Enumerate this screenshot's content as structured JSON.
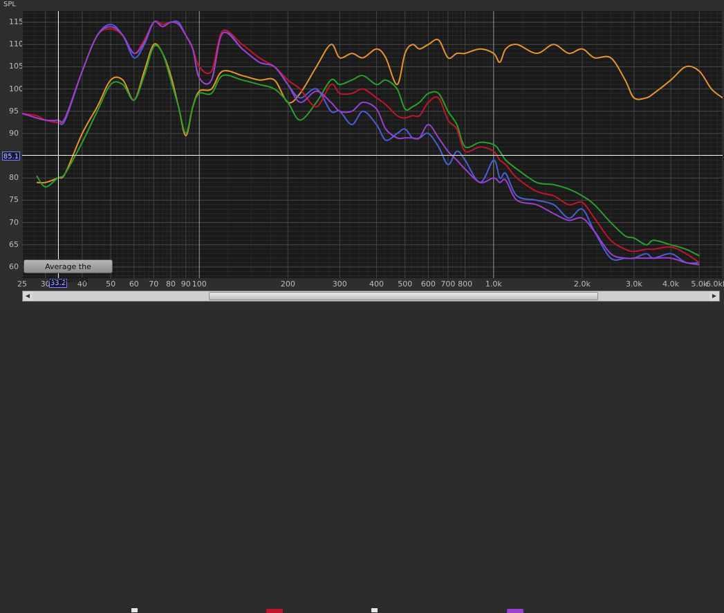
{
  "app": {
    "y_axis_title": "SPL",
    "average_button_label": "Average the Responses",
    "cursor": {
      "x_readout": "33.2",
      "y_readout": "85.1"
    },
    "scroll_left_icon": "scroll-left-arrow-icon",
    "scroll_right_icon": "scroll-right-arrow-icon"
  },
  "chart_data": {
    "type": "line",
    "ylabel": "SPL",
    "xlabel": "",
    "x_scale": "log",
    "xlim": [
      25,
      6000
    ],
    "ylim": [
      57.5,
      117.5
    ],
    "grid": true,
    "y_ticks": [
      "115",
      "110",
      "105",
      "100",
      "95",
      "90",
      "85.1",
      "80",
      "75",
      "70",
      "65",
      "60"
    ],
    "y_tick_values": [
      115,
      110,
      105,
      100,
      95,
      90,
      80,
      75,
      70,
      65,
      60
    ],
    "x_ticks": [
      "25",
      "30",
      "40",
      "50",
      "60",
      "70",
      "80",
      "90",
      "100",
      "200",
      "300",
      "400",
      "500",
      "600",
      "700",
      "800",
      "1.0k",
      "2.0k",
      "3.0k",
      "4.0k",
      "5.0k",
      "6.0kHz"
    ],
    "x_tick_values": [
      25,
      30,
      40,
      50,
      60,
      70,
      80,
      90,
      100,
      200,
      300,
      400,
      500,
      600,
      700,
      800,
      1000,
      2000,
      3000,
      4000,
      5000,
      6000
    ],
    "cursor": {
      "x": 33.2,
      "y": 85.1
    },
    "series": [
      {
        "color": "#e8952a",
        "x": [
          28,
          30,
          33,
          35,
          40,
          45,
          50,
          55,
          60,
          65,
          70,
          75,
          80,
          85,
          90,
          95,
          100,
          110,
          120,
          140,
          160,
          180,
          200,
          220,
          250,
          280,
          300,
          330,
          360,
          400,
          430,
          470,
          500,
          530,
          560,
          600,
          650,
          700,
          750,
          800,
          900,
          1000,
          1050,
          1100,
          1200,
          1400,
          1600,
          1800,
          2000,
          2200,
          2500,
          2800,
          3000,
          3300,
          3500,
          4000,
          4500,
          5000,
          5500,
          6000
        ],
        "y": [
          79,
          79,
          80,
          81,
          90,
          96,
          102,
          102,
          97.5,
          104,
          110,
          108,
          103,
          96,
          89.5,
          96,
          99.5,
          100,
          104,
          103,
          102,
          102,
          97,
          99,
          105,
          110,
          107,
          108,
          107,
          109,
          107,
          101,
          108,
          110,
          109,
          110,
          111,
          107,
          108,
          108,
          109,
          108,
          106,
          109,
          110,
          108,
          110,
          108,
          109,
          107,
          107,
          102,
          98,
          98,
          99,
          102,
          105,
          104,
          100,
          98
        ]
      },
      {
        "color": "#2aa02a",
        "x": [
          28,
          30,
          33,
          35,
          40,
          45,
          50,
          55,
          60,
          65,
          70,
          75,
          80,
          85,
          90,
          95,
          100,
          110,
          120,
          140,
          160,
          180,
          200,
          220,
          250,
          280,
          300,
          330,
          360,
          400,
          430,
          470,
          500,
          530,
          560,
          600,
          650,
          700,
          750,
          800,
          900,
          1000,
          1050,
          1100,
          1200,
          1400,
          1600,
          1800,
          2000,
          2200,
          2500,
          2800,
          3000,
          3300,
          3500,
          4000,
          4500,
          5000
        ],
        "y": [
          80.5,
          78,
          80,
          81,
          88,
          95,
          101,
          101,
          97.5,
          103,
          109.5,
          108,
          102,
          96,
          90,
          96,
          99,
          99,
          103,
          102,
          101,
          100,
          97,
          93,
          97,
          102,
          101,
          102,
          103,
          101,
          102,
          100,
          95.5,
          96,
          97,
          99,
          99,
          95,
          92,
          87,
          88,
          87.5,
          86,
          84,
          82,
          79,
          78.5,
          77.5,
          76,
          74,
          70,
          67,
          66.5,
          65,
          66,
          65,
          64,
          62.5
        ]
      },
      {
        "color": "#4a5fd6",
        "x": [
          25,
          28,
          30,
          33,
          35,
          40,
          45,
          50,
          55,
          60,
          65,
          70,
          75,
          80,
          85,
          90,
          95,
          100,
          110,
          120,
          140,
          160,
          180,
          200,
          220,
          250,
          280,
          300,
          330,
          360,
          400,
          430,
          470,
          500,
          530,
          560,
          600,
          650,
          700,
          750,
          800,
          900,
          1000,
          1050,
          1100,
          1200,
          1400,
          1600,
          1800,
          2000,
          2200,
          2500,
          2800,
          3000,
          3300,
          3500,
          4000,
          4500,
          5000
        ],
        "y": [
          94.5,
          93.5,
          93,
          92.5,
          93,
          104,
          112,
          114.5,
          112,
          107,
          110,
          115,
          114.5,
          115,
          115,
          112,
          109,
          102.5,
          102,
          113,
          109,
          106,
          105,
          101,
          98,
          100,
          95,
          95,
          92,
          95,
          92,
          88.5,
          90,
          91,
          89,
          89,
          90,
          87,
          83,
          86,
          84,
          79,
          84,
          80,
          81,
          76,
          75,
          74,
          71,
          73,
          68,
          62,
          62,
          62,
          63,
          62,
          63,
          61,
          61
        ]
      },
      {
        "color": "#c0152a",
        "x": [
          25,
          28,
          30,
          33,
          35,
          40,
          45,
          50,
          55,
          60,
          65,
          70,
          75,
          80,
          85,
          90,
          95,
          100,
          110,
          120,
          140,
          160,
          180,
          200,
          220,
          250,
          280,
          300,
          330,
          360,
          400,
          430,
          470,
          500,
          530,
          560,
          600,
          650,
          700,
          750,
          800,
          900,
          1000,
          1050,
          1100,
          1200,
          1400,
          1600,
          1800,
          2000,
          2200,
          2500,
          2800,
          3000,
          3300,
          3500,
          4000,
          4500,
          5000
        ],
        "y": [
          94.5,
          94,
          93,
          92.5,
          93.5,
          104,
          112,
          113.5,
          112,
          108,
          111,
          115,
          114.5,
          115,
          114.5,
          112,
          109,
          105,
          104,
          113,
          110,
          107,
          105,
          102,
          100,
          96,
          101,
          99,
          99,
          100,
          98,
          96.5,
          94,
          93.5,
          94,
          94,
          97,
          98,
          93,
          91,
          86,
          87,
          86,
          84,
          83,
          80,
          77,
          76,
          74,
          74.5,
          71,
          66,
          64,
          63.5,
          64,
          64,
          64.5,
          63,
          61
        ]
      },
      {
        "color": "#9b3fd1",
        "x": [
          25,
          28,
          30,
          33,
          35,
          40,
          45,
          50,
          55,
          60,
          65,
          70,
          75,
          80,
          85,
          90,
          95,
          100,
          110,
          120,
          140,
          160,
          180,
          200,
          220,
          250,
          280,
          300,
          330,
          360,
          400,
          430,
          470,
          500,
          530,
          560,
          600,
          650,
          700,
          750,
          800,
          900,
          1000,
          1050,
          1100,
          1200,
          1400,
          1600,
          1800,
          2000,
          2200,
          2500,
          2800,
          3000,
          3300,
          3500,
          4000,
          4500,
          5000
        ],
        "y": [
          94.5,
          93.5,
          93,
          93,
          93.5,
          104,
          112,
          114,
          112,
          108,
          110.5,
          115,
          114,
          115,
          114.5,
          112,
          109,
          102.5,
          102,
          112.5,
          109,
          106,
          105,
          101,
          97,
          99.5,
          97,
          95,
          95,
          97,
          95.5,
          91,
          89,
          89,
          89,
          89,
          92,
          89,
          86,
          84,
          82,
          79,
          80,
          79,
          79.5,
          75,
          74,
          72,
          70.5,
          71,
          68,
          63,
          62,
          62,
          62,
          62,
          62,
          61,
          60.5
        ]
      }
    ]
  }
}
